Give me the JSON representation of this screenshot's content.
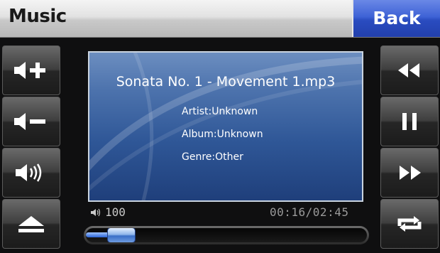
{
  "header": {
    "title": "Music",
    "back_label": "Back"
  },
  "left_controls": [
    {
      "name": "volume-up",
      "icon": "volume-up-icon"
    },
    {
      "name": "volume-down",
      "icon": "volume-down-icon"
    },
    {
      "name": "mute",
      "icon": "speaker-icon"
    },
    {
      "name": "eject",
      "icon": "eject-icon"
    }
  ],
  "right_controls": [
    {
      "name": "rewind",
      "icon": "rewind-icon"
    },
    {
      "name": "pause",
      "icon": "pause-icon"
    },
    {
      "name": "fast-forward",
      "icon": "fast-forward-icon"
    },
    {
      "name": "repeat",
      "icon": "repeat-icon"
    }
  ],
  "track": {
    "filename": "Sonata No. 1 - Movement 1.mp3",
    "artist": "Artist:Unknown",
    "album": "Album:Unknown",
    "genre": "Genre:Other"
  },
  "status": {
    "volume": "100",
    "time": "00:16/02:45"
  },
  "progress": {
    "fraction": 0.1
  },
  "colors": {
    "accent_blue": "#3f63d6",
    "screen_blue": "#2f5797",
    "button_dark": "#262626"
  }
}
